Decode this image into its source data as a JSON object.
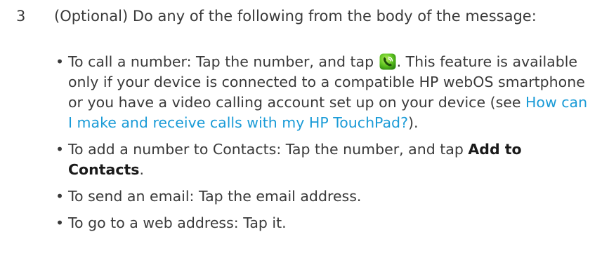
{
  "step": {
    "number": "3",
    "text": "(Optional) Do any of the following from the body of the message:"
  },
  "bullets": {
    "call": {
      "before_icon": "To call a number: Tap the number, and tap ",
      "icon": "phone-call-icon",
      "after_icon": ". This feature is available only if your device is connected to a compatible HP webOS smartphone or you have a video calling account set up on your device (see ",
      "link": "How can I make and receive calls with my HP TouchPad?",
      "end": ")."
    },
    "contacts": {
      "text": "To add a number to Contacts: Tap the number, and tap ",
      "bold": "Add to Contacts",
      "end": "."
    },
    "email": {
      "text": "To send an email: Tap the email address."
    },
    "web": {
      "text": "To go to a web address: Tap it."
    }
  },
  "colors": {
    "text": "#3a3a3a",
    "link": "#1a9bd7",
    "icon_green": "#5cc21f"
  }
}
